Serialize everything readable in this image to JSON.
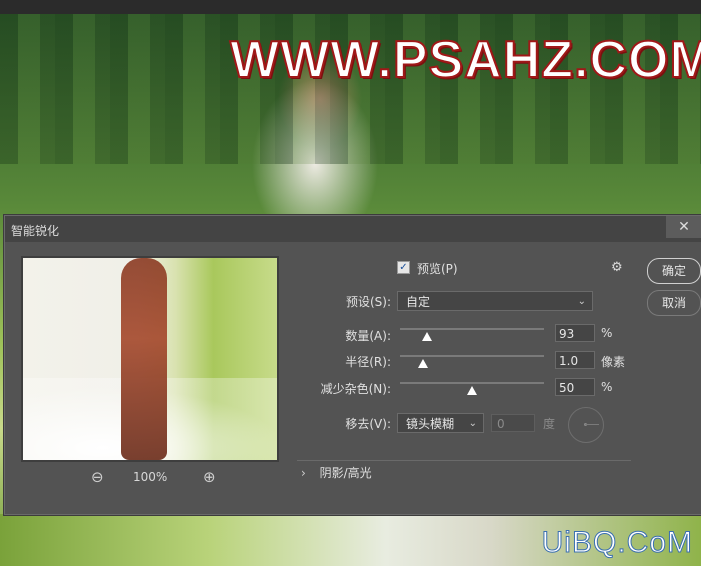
{
  "background": {
    "watermark_top": "WWW.PSAHZ.COM",
    "watermark_bottom": "UiBQ.CoM"
  },
  "dialog": {
    "title": "智能锐化",
    "close_icon": "close-icon",
    "preview_checkbox_checked": true,
    "preview_label": "预览(P)",
    "gear_icon": "gear-icon",
    "ok_label": "确定",
    "cancel_label": "取消",
    "preset": {
      "label": "预设(S):",
      "value": "自定"
    },
    "amount": {
      "label": "数量(A):",
      "value": "93",
      "unit": "%",
      "level": 0.19
    },
    "radius": {
      "label": "半径(R):",
      "value": "1.0",
      "unit": "像素",
      "level": 0.16
    },
    "reduce_noise": {
      "label": "减少杂色(N):",
      "value": "50",
      "unit": "%",
      "level": 0.5
    },
    "remove": {
      "label": "移去(V):",
      "value": "镜头模糊",
      "angle_value": "0",
      "angle_unit": "度"
    },
    "shadows_highlights_label": "阴影/高光",
    "zoom": {
      "zoom_out_icon": "zoom-out-icon",
      "level": "100%",
      "zoom_in_icon": "zoom-in-icon"
    }
  },
  "colors": {
    "dialog_bg": "#535353",
    "titlebar_bg": "#444444",
    "watermark_stroke": "#a01818"
  }
}
